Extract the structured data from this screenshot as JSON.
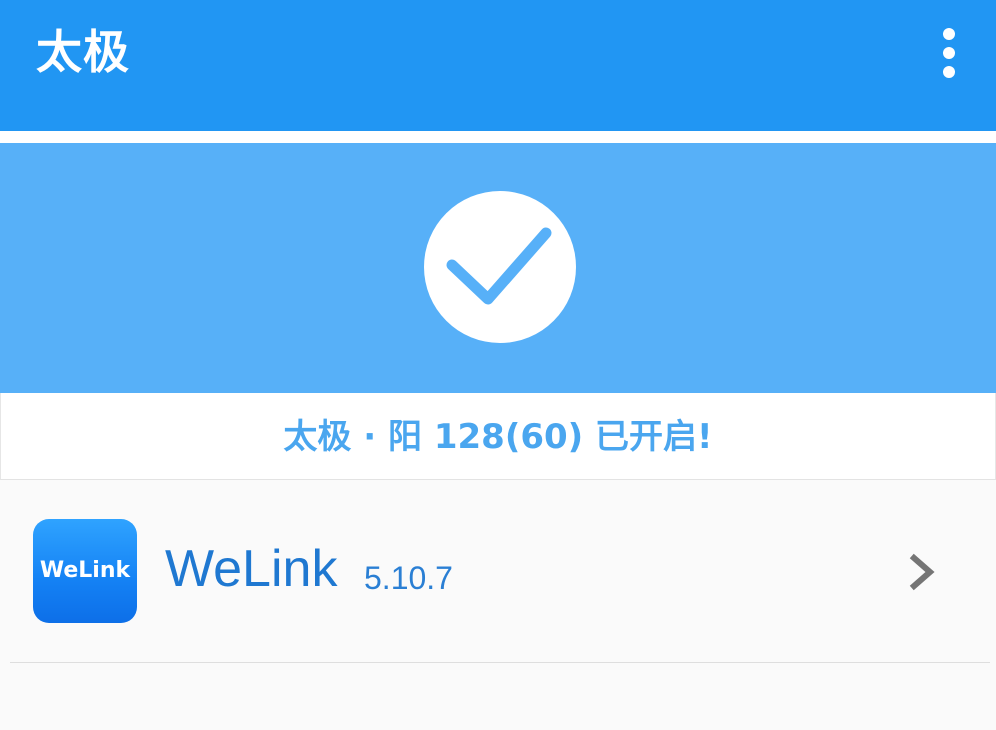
{
  "appbar": {
    "title": "太极",
    "overflow_icon": "more-vert-icon",
    "color": "#2196f3"
  },
  "status": {
    "icon": "check-icon",
    "banner_color": "#57b0f8",
    "text": "太极 · 阳 128(60) 已开启!"
  },
  "modules": [
    {
      "icon_text": "WeLink",
      "name": "WeLink",
      "version": "5.10.7",
      "chevron_icon": "chevron-right-icon"
    }
  ]
}
